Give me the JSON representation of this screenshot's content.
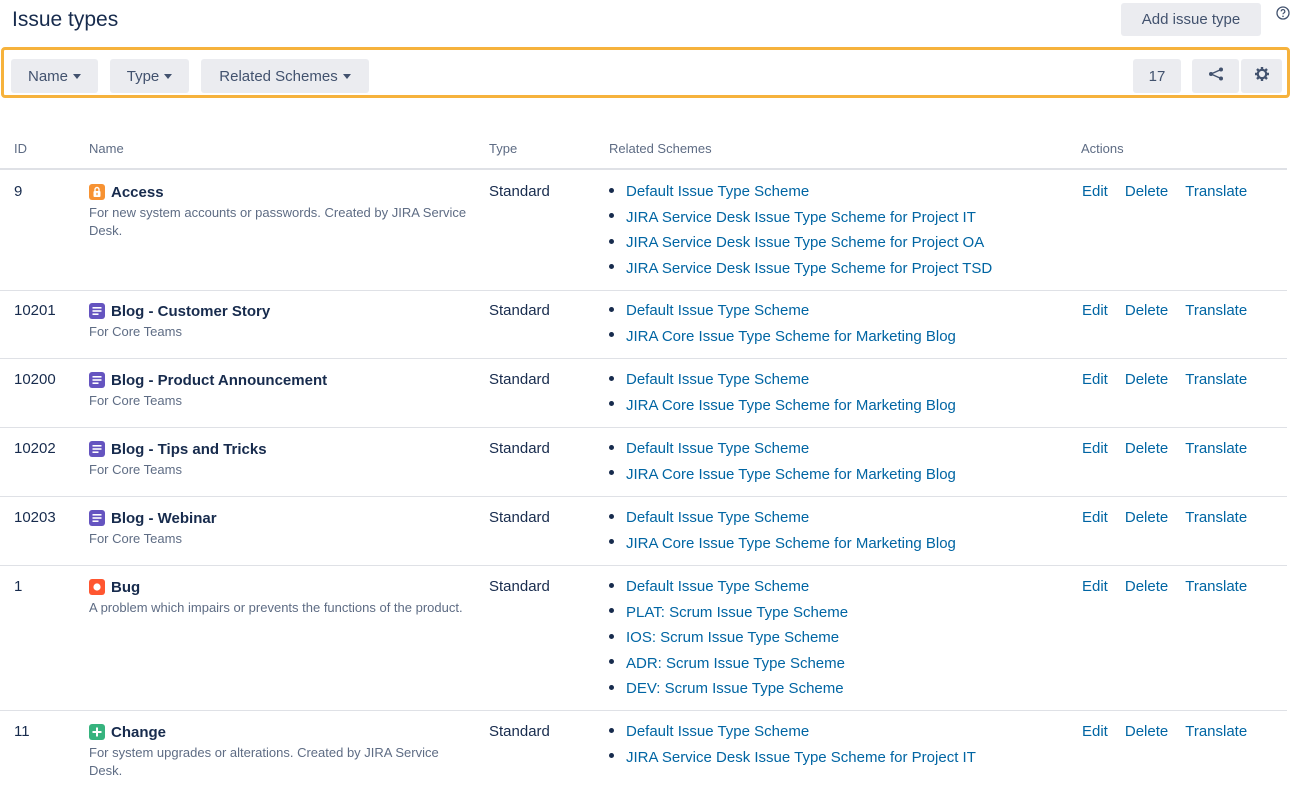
{
  "page": {
    "title": "Issue types",
    "add_button": "Add issue type",
    "help_icon": "question-circle-icon"
  },
  "toolbar": {
    "filters": [
      "Name",
      "Type",
      "Related Schemes"
    ],
    "count": "17",
    "share_icon": "share-icon",
    "settings_icon": "gear-icon",
    "highlight_color": "#f6b23c"
  },
  "table": {
    "headers": [
      "ID",
      "Name",
      "Type",
      "Related Schemes",
      "Actions"
    ],
    "rows": [
      {
        "id": "9",
        "icon": "lock-icon",
        "icon_color": "#f79232",
        "name": "Access",
        "description": "For new system accounts or passwords. Created by JIRA Service Desk.",
        "type": "Standard",
        "schemes": [
          "Default Issue Type Scheme",
          "JIRA Service Desk Issue Type Scheme for Project IT",
          "JIRA Service Desk Issue Type Scheme for Project OA",
          "JIRA Service Desk Issue Type Scheme for Project TSD"
        ],
        "actions": [
          "Edit",
          "Delete",
          "Translate"
        ]
      },
      {
        "id": "10201",
        "icon": "document-icon",
        "icon_color": "#6554c0",
        "name": "Blog - Customer Story",
        "description": "For Core Teams",
        "type": "Standard",
        "schemes": [
          "Default Issue Type Scheme",
          "JIRA Core Issue Type Scheme for Marketing Blog"
        ],
        "actions": [
          "Edit",
          "Delete",
          "Translate"
        ]
      },
      {
        "id": "10200",
        "icon": "document-icon",
        "icon_color": "#6554c0",
        "name": "Blog - Product Announcement",
        "description": "For Core Teams",
        "type": "Standard",
        "schemes": [
          "Default Issue Type Scheme",
          "JIRA Core Issue Type Scheme for Marketing Blog"
        ],
        "actions": [
          "Edit",
          "Delete",
          "Translate"
        ]
      },
      {
        "id": "10202",
        "icon": "document-icon",
        "icon_color": "#6554c0",
        "name": "Blog - Tips and Tricks",
        "description": "For Core Teams",
        "type": "Standard",
        "schemes": [
          "Default Issue Type Scheme",
          "JIRA Core Issue Type Scheme for Marketing Blog"
        ],
        "actions": [
          "Edit",
          "Delete",
          "Translate"
        ]
      },
      {
        "id": "10203",
        "icon": "document-icon",
        "icon_color": "#6554c0",
        "name": "Blog - Webinar",
        "description": "For Core Teams",
        "type": "Standard",
        "schemes": [
          "Default Issue Type Scheme",
          "JIRA Core Issue Type Scheme for Marketing Blog"
        ],
        "actions": [
          "Edit",
          "Delete",
          "Translate"
        ]
      },
      {
        "id": "1",
        "icon": "bug-icon",
        "icon_color": "#ff5630",
        "name": "Bug",
        "description": "A problem which impairs or prevents the functions of the product.",
        "type": "Standard",
        "schemes": [
          "Default Issue Type Scheme",
          "PLAT: Scrum Issue Type Scheme",
          "IOS: Scrum Issue Type Scheme",
          "ADR: Scrum Issue Type Scheme",
          "DEV: Scrum Issue Type Scheme"
        ],
        "actions": [
          "Edit",
          "Delete",
          "Translate"
        ]
      },
      {
        "id": "11",
        "icon": "plus-icon",
        "icon_color": "#36b37e",
        "name": "Change",
        "description": "For system upgrades or alterations. Created by JIRA Service Desk.",
        "type": "Standard",
        "schemes": [
          "Default Issue Type Scheme",
          "JIRA Service Desk Issue Type Scheme for Project IT"
        ],
        "actions": [
          "Edit",
          "Delete",
          "Translate"
        ]
      }
    ]
  }
}
